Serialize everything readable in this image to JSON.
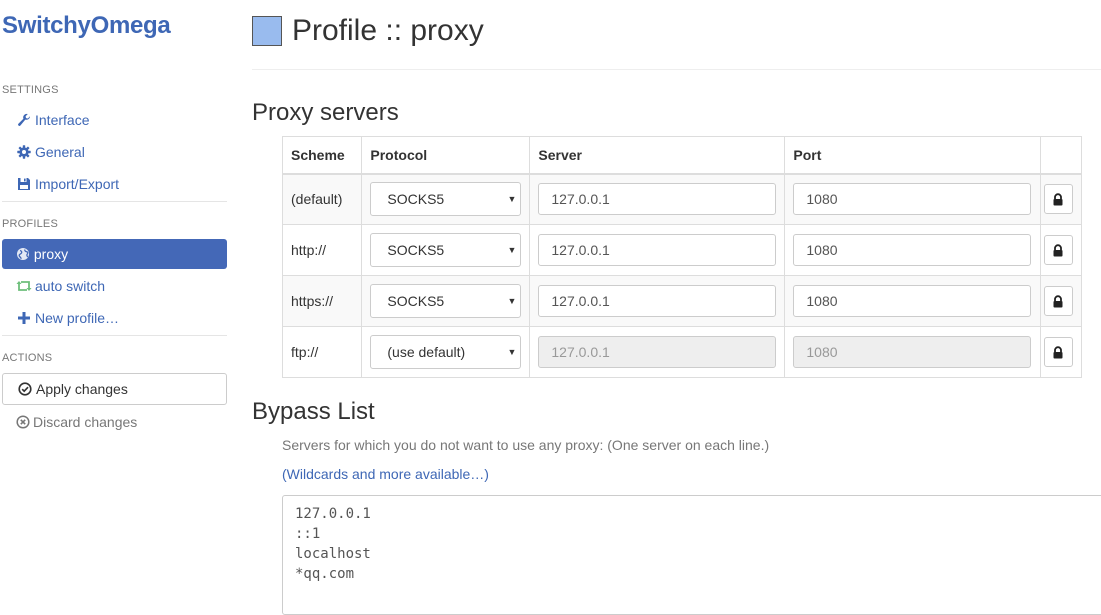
{
  "brand": "SwitchyOmega",
  "sidebar": {
    "settings_header": "SETTINGS",
    "settings_items": [
      {
        "label": "Interface",
        "icon": "wrench-icon"
      },
      {
        "label": "General",
        "icon": "gear-icon"
      },
      {
        "label": "Import/Export",
        "icon": "floppy-icon"
      }
    ],
    "profiles_header": "PROFILES",
    "profiles_items": [
      {
        "label": "proxy",
        "icon": "globe-icon",
        "active": true
      },
      {
        "label": "auto switch",
        "icon": "retweet-icon"
      },
      {
        "label": "New profile…",
        "icon": "plus-icon"
      }
    ],
    "actions_header": "ACTIONS",
    "apply_label": "Apply changes",
    "discard_label": "Discard changes"
  },
  "header": {
    "title": "Profile :: proxy",
    "swatch_color": "#99bbee"
  },
  "proxy_section": {
    "title": "Proxy servers",
    "columns": [
      "Scheme",
      "Protocol",
      "Server",
      "Port"
    ],
    "rows": [
      {
        "scheme": "(default)",
        "protocol": "SOCKS5",
        "server": "127.0.0.1",
        "port": "1080",
        "disabled": false
      },
      {
        "scheme": "http://",
        "protocol": "SOCKS5",
        "server": "127.0.0.1",
        "port": "1080",
        "disabled": false
      },
      {
        "scheme": "https://",
        "protocol": "SOCKS5",
        "server": "127.0.0.1",
        "port": "1080",
        "disabled": false
      },
      {
        "scheme": "ftp://",
        "protocol": "(use default)",
        "server": "127.0.0.1",
        "port": "1080",
        "disabled": true
      }
    ]
  },
  "bypass": {
    "title": "Bypass List",
    "help": "Servers for which you do not want to use any proxy: (One server on each line.)",
    "link": "(Wildcards and more available…)",
    "entries": [
      "127.0.0.1",
      "::1",
      "localhost",
      "*qq.com"
    ]
  },
  "colors": {
    "accent": "#3e67b5",
    "active_bg": "#4468b7"
  }
}
